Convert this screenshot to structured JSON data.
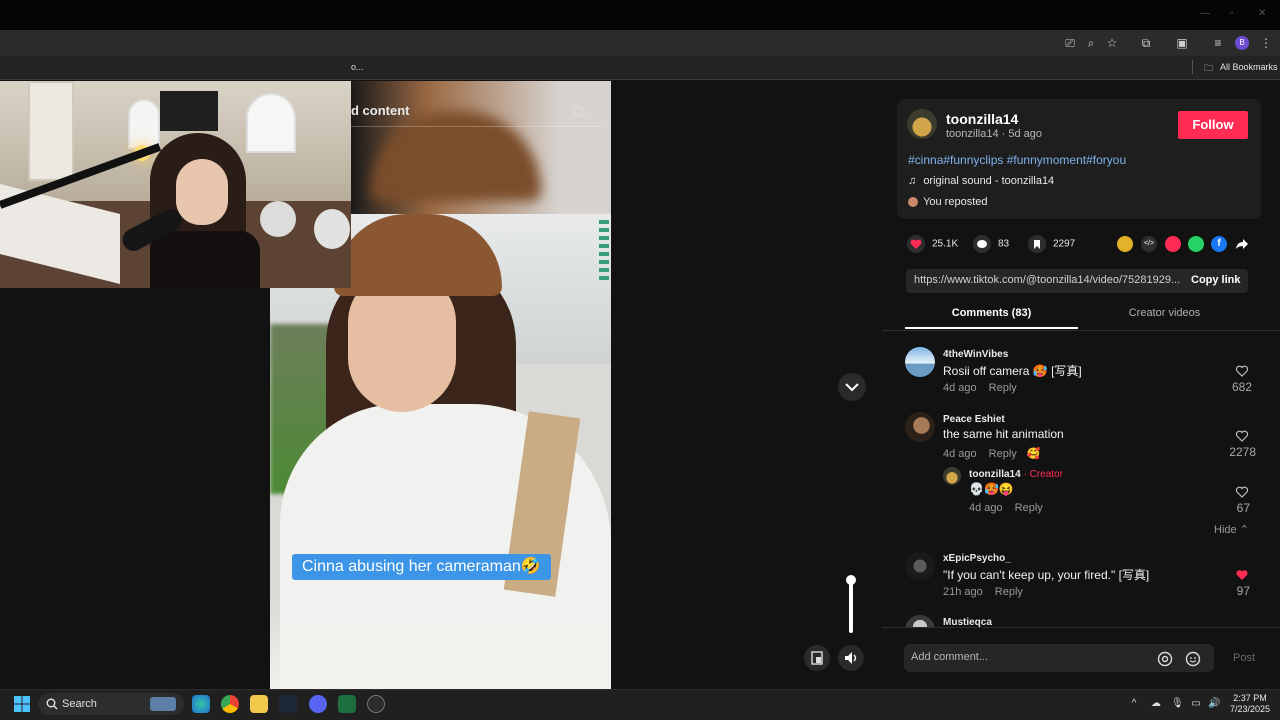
{
  "browser": {
    "partial_tab_text": "o...",
    "bookmarks_label": "All Bookmarks",
    "profile_initial": "B"
  },
  "video": {
    "search_partial": "d content",
    "faint_number": "0",
    "caption": "Cinna abusing her cameraman🤣"
  },
  "post": {
    "author": "toonzilla14",
    "subline": "toonzilla14 · 5d ago",
    "follow_label": "Follow",
    "hashtags": "#cinna#funnyclips #funnymoment#foryou",
    "sound": "original sound - toonzilla14",
    "repost": "You reposted",
    "likes": "25.1K",
    "comments": "83",
    "saves": "2297",
    "link": "https://www.tiktok.com/@toonzilla14/video/75281929...",
    "copy_link_label": "Copy link",
    "tabs": {
      "comments": "Comments (83)",
      "creator": "Creator videos"
    }
  },
  "comments": [
    {
      "name": "4theWinVibes",
      "text": "Rosii off camera 🥵 [写真]",
      "meta": "4d ago",
      "reply": "Reply",
      "likes": "682"
    },
    {
      "name": "Peace Eshiet",
      "text": "the same hit animation",
      "meta": "4d ago",
      "reply": "Reply",
      "likes": "2278",
      "extra": "🥰"
    },
    {
      "name": "toonzilla14",
      "creator_tag": " · Creator",
      "text": "💀🥵😝",
      "meta": "4d ago",
      "reply": "Reply",
      "likes": "67"
    },
    {
      "name": "xEpicPsycho_",
      "text": "\"If you can't keep up, your fired.\" [写真]",
      "meta": "21h ago",
      "reply": "Reply",
      "likes": "97"
    },
    {
      "name": "Mustieqca"
    }
  ],
  "hide_label": "Hide",
  "comment_bar": {
    "placeholder": "Add comment...",
    "post_label": "Post"
  },
  "taskbar": {
    "search_label": "Search",
    "time": "2:37 PM",
    "date": "7/23/2025"
  },
  "colors": {
    "accent": "#fe2c55",
    "hashtag": "#7fb2ec",
    "caption_bg": "#3c95e6",
    "liked_heart": "#fe2c55"
  },
  "icons": [
    "search-icon",
    "music-note-icon",
    "heart-icon",
    "comment-icon",
    "bookmark-icon",
    "share-icon",
    "chevron-down-icon",
    "volume-icon",
    "at-icon",
    "emoji-icon",
    "windows-start-icon"
  ]
}
